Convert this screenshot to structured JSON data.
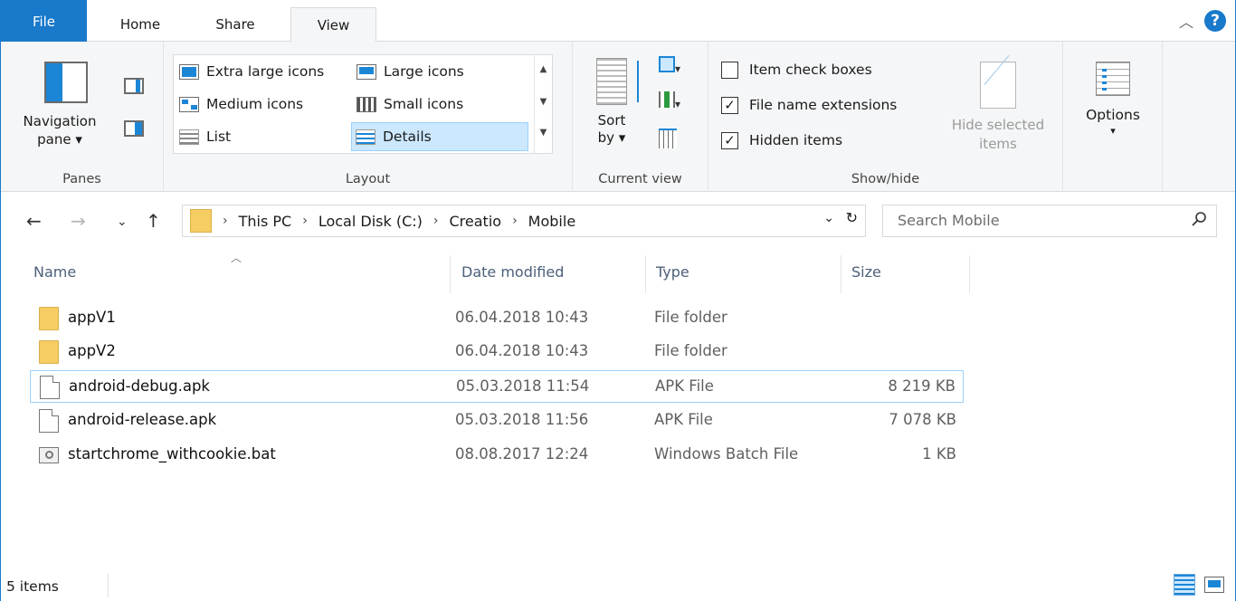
{
  "ribbon_tabs": {
    "file": "File",
    "home": "Home",
    "share": "Share",
    "view": "View"
  },
  "panes": {
    "navigation_pane": "Navigation",
    "navigation_pane_2": "pane ▾",
    "label": "Panes"
  },
  "layout": {
    "label": "Layout",
    "extra_large": "Extra large icons",
    "large": "Large icons",
    "medium": "Medium icons",
    "small": "Small icons",
    "list": "List",
    "details": "Details"
  },
  "current_view": {
    "sort_1": "Sort",
    "sort_2": "by ▾",
    "label": "Current view"
  },
  "show_hide": {
    "label": "Show/hide",
    "item_check_boxes": {
      "label": "Item check boxes",
      "checked": false
    },
    "file_name_extensions": {
      "label": "File name extensions",
      "checked": true
    },
    "hidden_items": {
      "label": "Hidden items",
      "checked": true
    },
    "hide_selected_1": "Hide selected",
    "hide_selected_2": "items"
  },
  "options": {
    "label": "Options",
    "caret": "▾"
  },
  "address": {
    "crumbs": [
      "This PC",
      "Local Disk (C:)",
      "Creatio",
      "Mobile"
    ]
  },
  "search": {
    "placeholder": "Search Mobile"
  },
  "columns": {
    "name": "Name",
    "date": "Date modified",
    "type": "Type",
    "size": "Size"
  },
  "files": [
    {
      "name": "appV1",
      "date": "06.04.2018 10:43",
      "type": "File folder",
      "size": "",
      "kind": "folder"
    },
    {
      "name": "appV2",
      "date": "06.04.2018 10:43",
      "type": "File folder",
      "size": "",
      "kind": "folder"
    },
    {
      "name": "android-debug.apk",
      "date": "05.03.2018 11:54",
      "type": "APK File",
      "size": "8 219 KB",
      "kind": "file"
    },
    {
      "name": "android-release.apk",
      "date": "05.03.2018 11:56",
      "type": "APK File",
      "size": "7 078 KB",
      "kind": "file"
    },
    {
      "name": "startchrome_withcookie.bat",
      "date": "08.08.2017 12:24",
      "type": "Windows Batch File",
      "size": "1 KB",
      "kind": "bat"
    }
  ],
  "status": {
    "item_count": "5 items"
  },
  "colors": {
    "accent": "#1979ca",
    "folder": "#f6cd62",
    "selection": "#cce8ff"
  }
}
